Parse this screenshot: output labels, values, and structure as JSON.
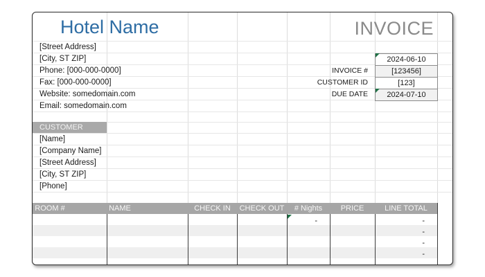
{
  "hotel": {
    "name": "Hotel Name",
    "street": "[Street Address]",
    "city": "[City, ST  ZIP]",
    "phone": "Phone: [000-000-0000]",
    "fax": "Fax: [000-000-0000]",
    "website": "Website: somedomain.com",
    "email": "Email: somedomain.com"
  },
  "invoice": {
    "title": "INVOICE",
    "date": "2024-06-10",
    "number_label": "INVOICE #",
    "number": "[123456]",
    "customer_id_label": "CUSTOMER ID",
    "customer_id": "[123]",
    "due_date_label": "DUE DATE",
    "due_date": "2024-07-10"
  },
  "customer": {
    "header": "CUSTOMER",
    "name": "[Name]",
    "company": "[Company Name]",
    "street": "[Street Address]",
    "city": "[City, ST  ZIP]",
    "phone": "[Phone]"
  },
  "table": {
    "columns": [
      "ROOM #",
      "NAME",
      "CHECK IN",
      "CHECK OUT",
      "# Nights",
      "PRICE",
      "LINE TOTAL"
    ],
    "rows": [
      {
        "nights": "-",
        "total": "-"
      },
      {
        "nights": "",
        "total": "-"
      },
      {
        "nights": "",
        "total": "-"
      },
      {
        "nights": "",
        "total": "-"
      }
    ]
  },
  "colors": {
    "hotel_name": "#2e6da4",
    "invoice_title": "#8a8a8a",
    "header_fill": "#a6a6a6",
    "cell_marker": "#1e7145"
  }
}
